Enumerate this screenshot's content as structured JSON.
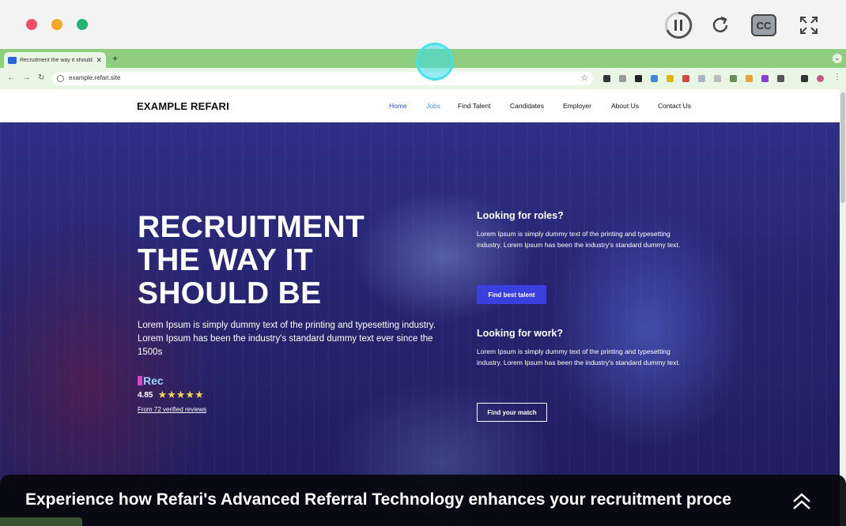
{
  "player": {
    "controls": {
      "pause_icon": "pause-icon",
      "replay_icon": "replay-icon",
      "cc_label": "CC",
      "fullscreen_icon": "fullscreen-icon"
    }
  },
  "browser": {
    "tab": {
      "title": "Recruitment the way it should"
    },
    "url": "example.refari.site"
  },
  "site": {
    "brand": "EXAMPLE REFARI",
    "nav": [
      "Home",
      "Jobs",
      "Find Talent",
      "Candidates",
      "Employer",
      "About Us",
      "Contact Us"
    ]
  },
  "hero": {
    "title_lines": [
      "RECRUITMENT",
      "THE WAY IT",
      "SHOULD BE"
    ],
    "description": "Lorem Ipsum is simply dummy text of the printing and typesetting industry. Lorem Ipsum has been the industry's standard dummy text ever since the 1500s",
    "rec_logo": "Rec",
    "rating": "4.85",
    "stars": "★★★★★",
    "reviews_link": "From 72 verified reviews",
    "roles": {
      "title": "Looking for roles?",
      "body": "Lorem Ipsum is simply dummy text of the printing and typesetting industry. Lorem Ipsum has been the industry's standard dummy text.",
      "button": "Find best talent"
    },
    "work": {
      "title": "Looking for work?",
      "body": "Lorem Ipsum is simply dummy text of the printing and typesetting industry. Lorem Ipsum has been the industry's standard dummy text.",
      "button": "Find your match"
    }
  },
  "caption": {
    "text": "Experience how Refari's Advanced Referral Technology enhances your recruitment proce"
  }
}
